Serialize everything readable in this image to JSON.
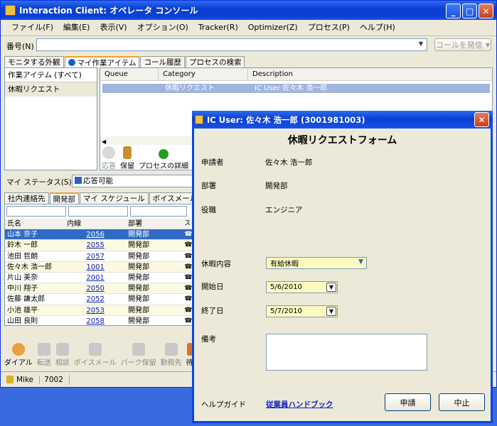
{
  "main_window": {
    "title": "Interaction Client: オペレータ コンソール",
    "menu": [
      "ファイル(F)",
      "編集(E)",
      "表示(V)",
      "オプション(O)",
      "Tracker(R)",
      "Optimizer(Z)",
      "プロセス(P)",
      "ヘルプ(H)"
    ],
    "number_label": "番号(N)",
    "call_button": "コールを発信",
    "top_tabs": [
      "モニタする外観",
      "マイ作業アイテム",
      "コール履歴",
      "プロセスの検索"
    ],
    "work_items": [
      "作業アイテム (すべて)",
      "休暇リクエスト"
    ],
    "queue_headers": {
      "queue": "Queue",
      "category": "Category",
      "description": "Description"
    },
    "queue_row": {
      "category": "休暇リクエスト",
      "description": "IC User 佐々木 浩一郎"
    },
    "queue_toolbar": {
      "answer": "応答",
      "hold": "保留",
      "process_detail": "プロセスの詳細"
    },
    "status_label": "マイ ステータス(S)",
    "status_value": "応答可能",
    "contact_tabs": [
      "社内連絡先",
      "開発部",
      "マイ スケジュール",
      "ボイスメール"
    ],
    "contact_headers": {
      "name": "氏名",
      "ext": "内線",
      "dept": "部署",
      "status": "ス"
    },
    "contacts": [
      {
        "name": "山本 奈子",
        "ext": "2056",
        "dept": "開発部"
      },
      {
        "name": "鈴木 一郎",
        "ext": "2055",
        "dept": "開発部"
      },
      {
        "name": "池田 哲朗",
        "ext": "2057",
        "dept": "開発部"
      },
      {
        "name": "佐々木 浩一郎",
        "ext": "1001",
        "dept": "開発部"
      },
      {
        "name": "片山 美奈",
        "ext": "2001",
        "dept": "開発部"
      },
      {
        "name": "中川 翔子",
        "ext": "2050",
        "dept": "開発部"
      },
      {
        "name": "佐藤 謙太郎",
        "ext": "2052",
        "dept": "開発部"
      },
      {
        "name": "小池 雄平",
        "ext": "2053",
        "dept": "開発部"
      },
      {
        "name": "山田 良則",
        "ext": "2058",
        "dept": "開発部"
      }
    ],
    "bottom_toolbar": [
      "ダイアル",
      "転送",
      "相談",
      "ボイスメール",
      "パーク保留",
      "勤務先",
      "待"
    ],
    "statusbar": {
      "user": "Mike",
      "ext": "7002"
    }
  },
  "dialog": {
    "title": "IC User: 佐々木 浩一郎 (3001981003)",
    "form_title": "休暇リクエストフォーム",
    "applicant_label": "申請者",
    "applicant_value": "佐々木 浩一郎",
    "dept_label": "部署",
    "dept_value": "開発部",
    "role_label": "役職",
    "role_value": "エンジニア",
    "leave_type_label": "休暇内容",
    "leave_type_value": "有給休暇",
    "start_label": "開始日",
    "start_value": "5/6/2010",
    "end_label": "終了日",
    "end_value": "5/7/2010",
    "notes_label": "備考",
    "help_label": "ヘルプガイド",
    "help_link": "従業員ハンドブック",
    "submit_button": "申請",
    "cancel_button": "中止"
  }
}
